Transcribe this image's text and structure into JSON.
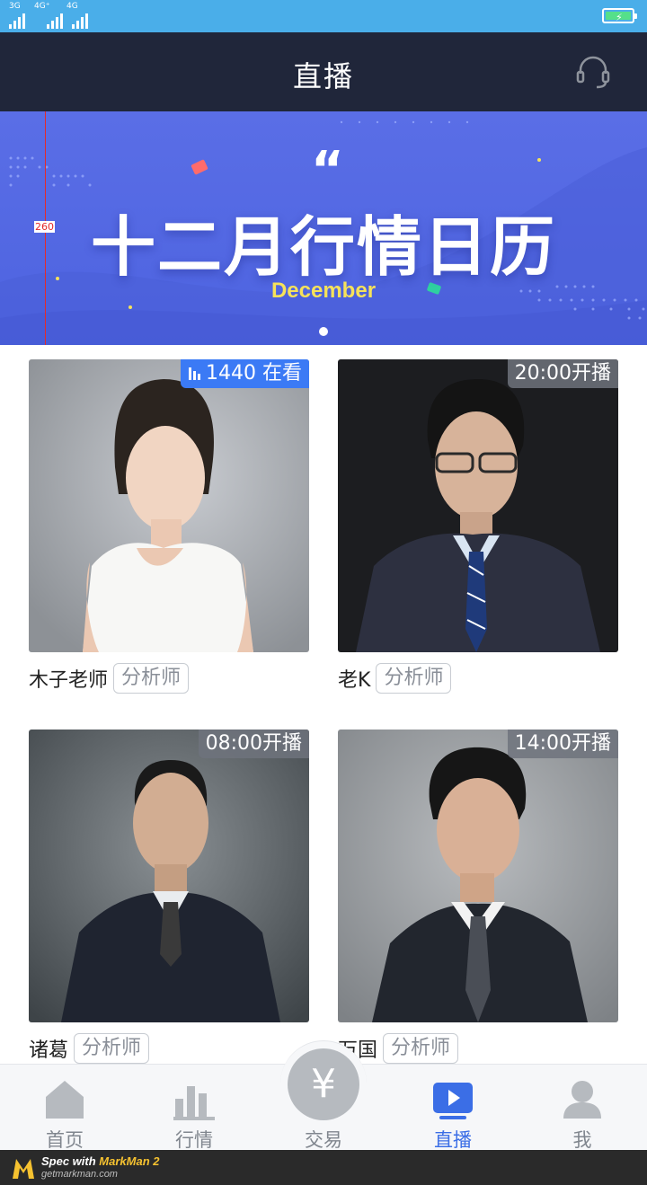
{
  "status_bar": {
    "network_1": "3G",
    "network_2": "4G⁺",
    "network_3": "4G",
    "battery_icon": "battery-charging-icon"
  },
  "header": {
    "title": "直播",
    "service_icon": "headset-icon"
  },
  "banner": {
    "headline": "十二月行情日历",
    "subtitle": "December",
    "quote_mark": "“",
    "measure_annotation": "260",
    "carousel_count": 1,
    "carousel_active": 1
  },
  "cards": [
    {
      "name": "木子老师",
      "role": "分析师",
      "badge": "1440 在看",
      "badge_icon": "bar-chart-icon",
      "status": "live"
    },
    {
      "name": "老K",
      "role": "分析师",
      "badge": "20:00开播",
      "status": "scheduled"
    },
    {
      "name": "诸葛",
      "role": "分析师",
      "badge": "08:00开播",
      "status": "scheduled"
    },
    {
      "name": "万国",
      "role": "分析师",
      "badge": "14:00开播",
      "status": "scheduled"
    }
  ],
  "tabbar": {
    "tabs": [
      {
        "label": "首页",
        "icon": "home-icon"
      },
      {
        "label": "行情",
        "icon": "bar-chart-icon"
      },
      {
        "label": "交易",
        "icon": "yen-icon",
        "glyph": "¥"
      },
      {
        "label": "直播",
        "icon": "play-icon"
      },
      {
        "label": "我",
        "icon": "person-icon"
      }
    ],
    "active": "直播"
  },
  "watermark": {
    "line1_prefix": "Spec with ",
    "line1_brand": "MarkMan 2",
    "line2": "getmarkman.com"
  },
  "colors": {
    "status_bar": "#4aaee9",
    "header": "#20263a",
    "banner": "#5a6ee6",
    "live_badge": "#3b7af5",
    "active_tab": "#3b6ee6",
    "subtitle": "#f6e25a"
  }
}
